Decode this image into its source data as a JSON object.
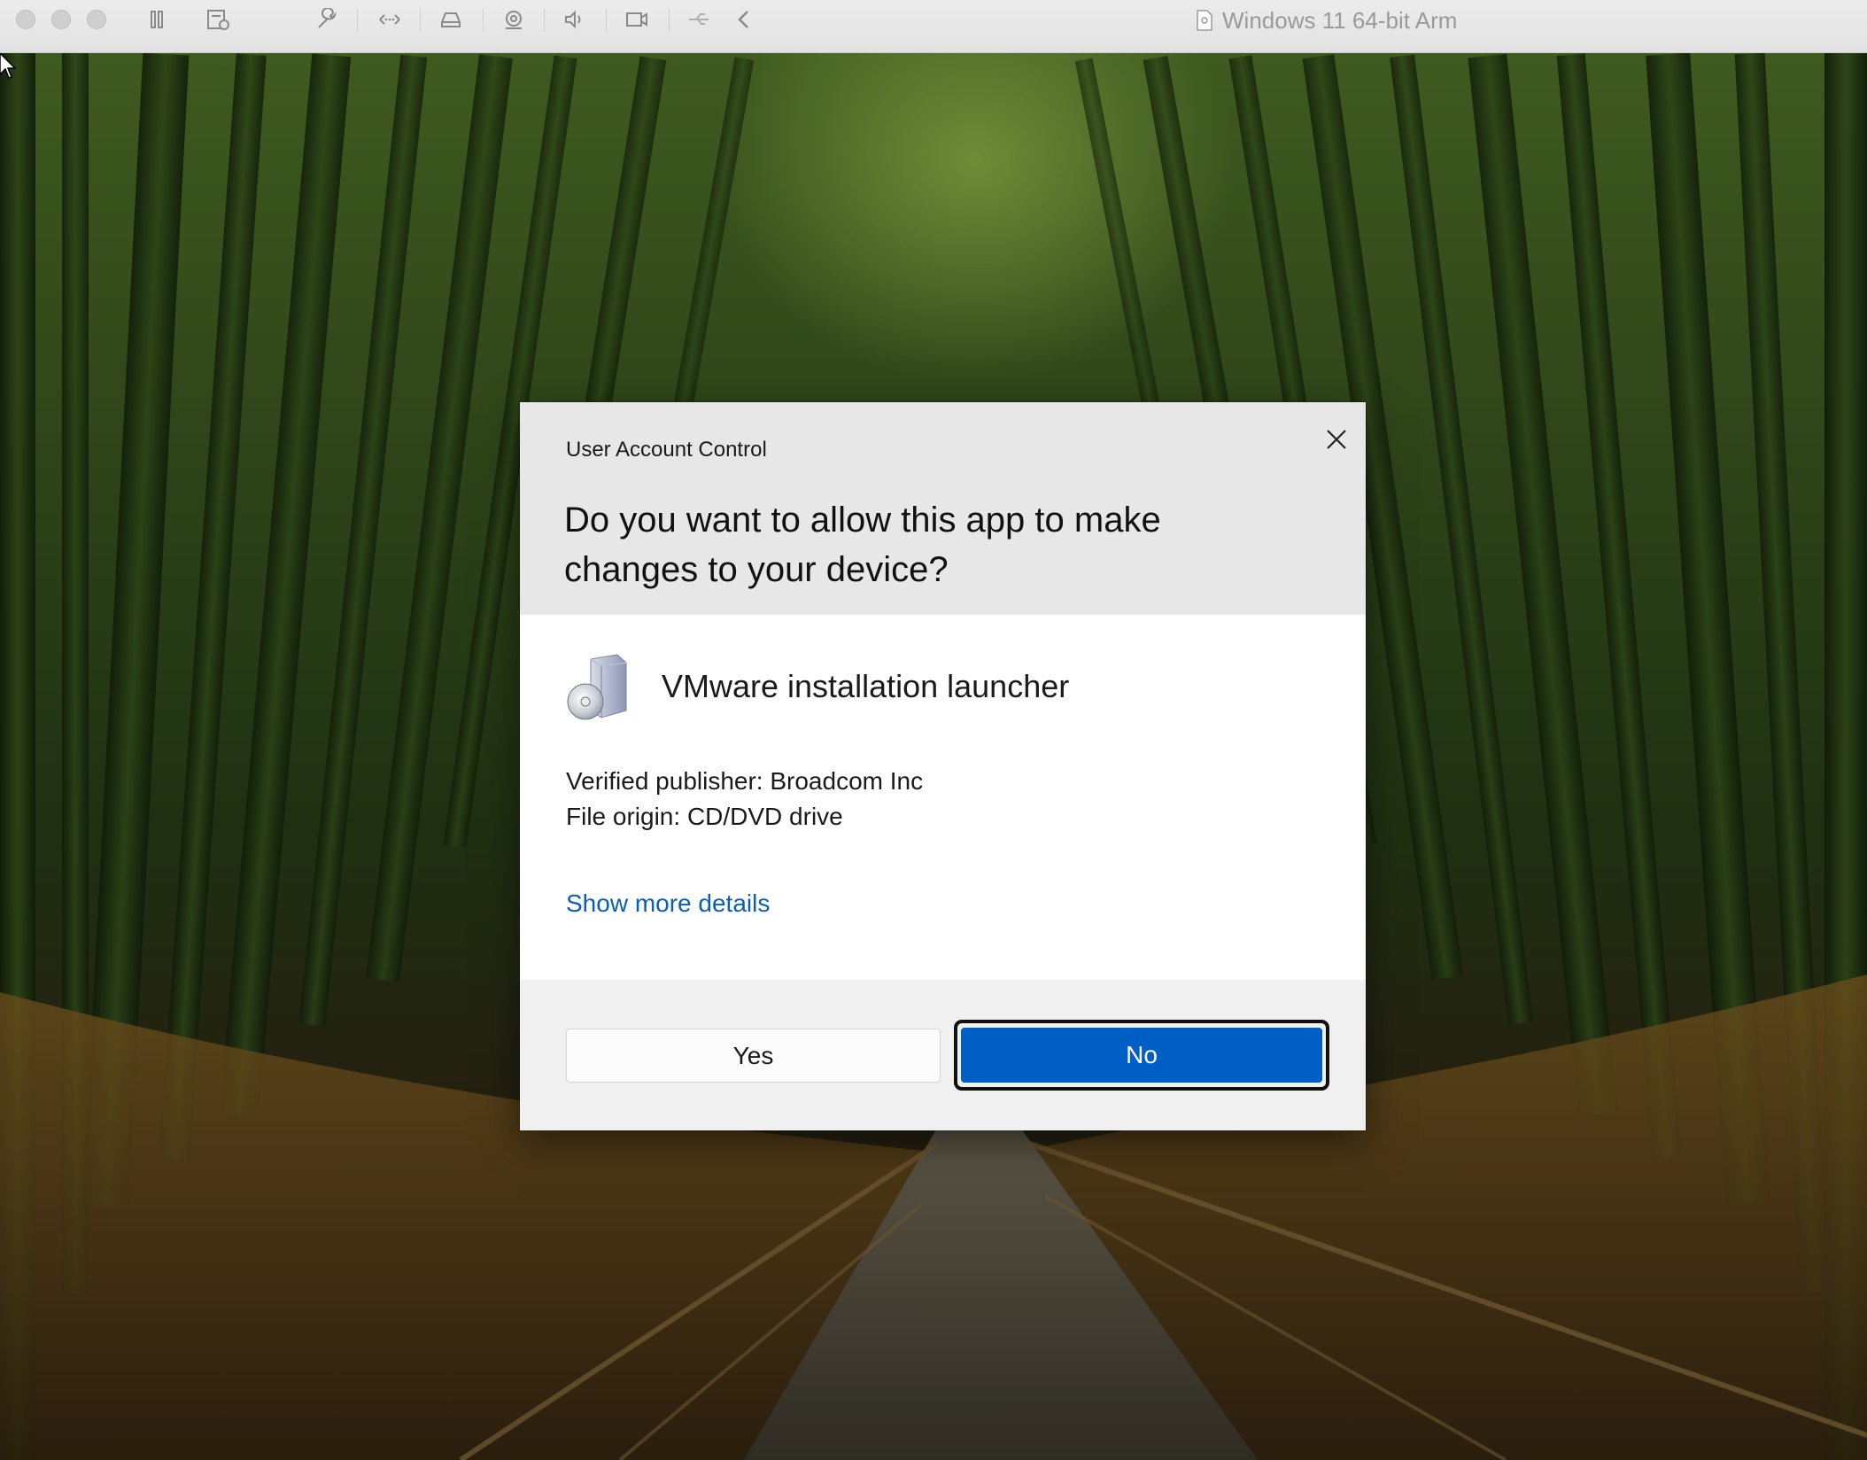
{
  "vm_window": {
    "title": "Windows 11 64-bit Arm",
    "toolbar_icons": [
      "pause-icon",
      "snapshot-icon",
      "settings-wrench-icon",
      "network-icon",
      "drive-icon",
      "camera-sharing-icon",
      "sound-icon",
      "video-camera-icon",
      "usb-icon",
      "back-chevron-icon"
    ]
  },
  "dialog": {
    "caption": "User Account Control",
    "question": "Do you want to allow this app to make changes to your device?",
    "app_name": "VMware installation launcher",
    "publisher_line": "Verified publisher: Broadcom Inc",
    "origin_line": "File origin: CD/DVD drive",
    "details_link": "Show more details",
    "yes_label": "Yes",
    "no_label": "No",
    "focused_button": "No"
  },
  "colors": {
    "accent": "#005fc6",
    "link": "#0a5fb4"
  }
}
